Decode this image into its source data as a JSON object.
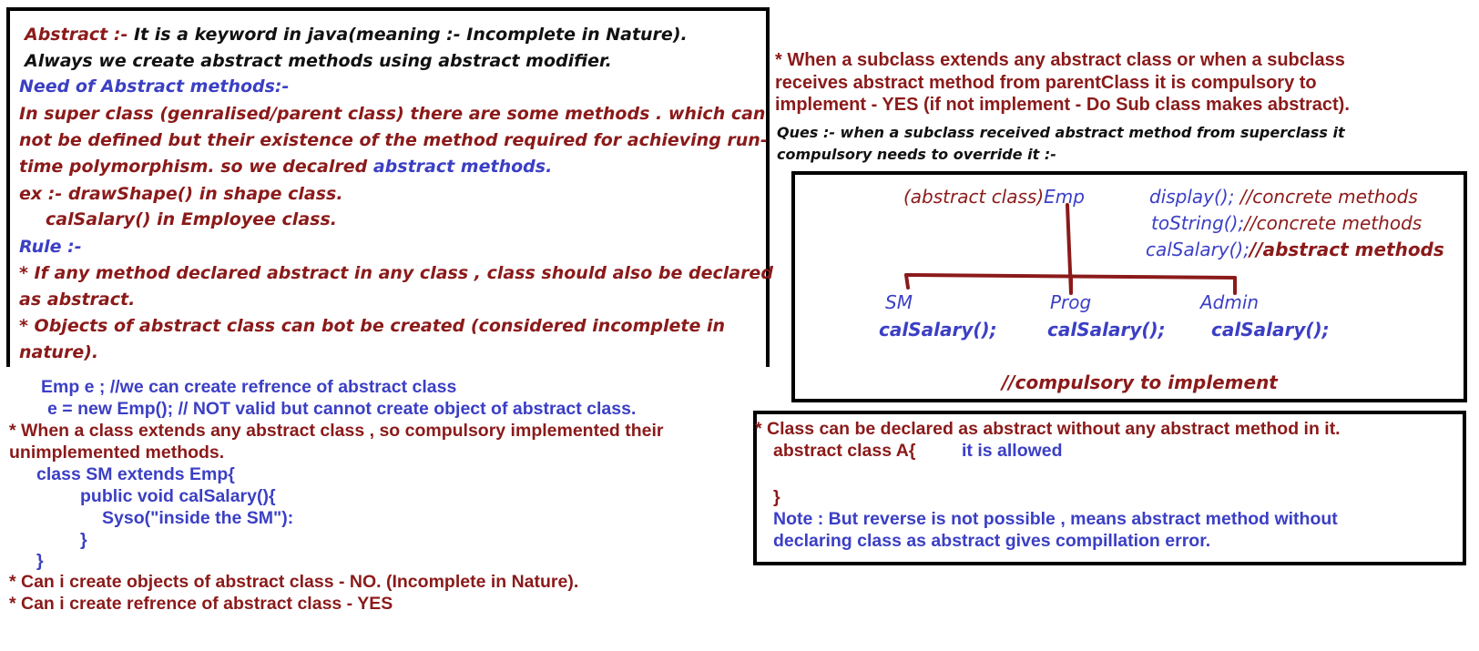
{
  "box1": {
    "line1_label": "Abstract :-",
    "line1_text": " It is a keyword in java(meaning :- Incomplete in Nature).",
    "line2": "Always we create abstract methods using abstract modifier.",
    "need_heading": "Need of Abstract methods:-",
    "need_l1": "In super class (genralised/parent class) there are some methods . which can",
    "need_l2": "not be defined but their existence of the method required for achieving run-",
    "need_l3a": "time polymorphism. so we decalred ",
    "need_l3b": "abstract methods.",
    "ex_l1": "ex :- drawShape() in shape class.",
    "ex_l2": "calSalary() in Employee class.",
    "rule_heading": "Rule :-",
    "rule1_l1": "* If any method declared abstract in any class , class should also be declared",
    "rule1_l2": "as abstract.",
    "rule2_l1": "* Objects of abstract class can bot be created (considered incomplete in",
    "rule2_l2": "nature)."
  },
  "left_bottom": {
    "l1": "Emp e ; //we can create refrence of abstract class",
    "l2": "e = new Emp(); // NOT valid but cannot create object of abstract class.",
    "l3": "* When a class extends any abstract class , so compulsory implemented their",
    "l4": "unimplemented methods.",
    "c1": "class SM extends Emp{",
    "c2": "public void calSalary(){",
    "c3": "Syso(\"inside the SM\"):",
    "c4": "}",
    "c5": "}",
    "q1": "* Can i create objects of abstract class - NO.  (Incomplete in Nature).",
    "q2": "* Can i create refrence of abstract class - YES"
  },
  "right_top": {
    "l1": "* When a subclass extends any abstract class or when  a subclass",
    "l2": "receives abstract method from parentClass it is compulsory to",
    "l3": "implement - YES (if not implement - Do Sub class makes abstract).",
    "ques_l1": "Ques :- when a subclass received abstract method from superclass it",
    "ques_l2": "compulsory needs to override it :-"
  },
  "diagram": {
    "parent_a": "(abstract class)",
    "parent_b": "Emp",
    "m1a": "display();",
    "m1b": " //concrete methods",
    "m2a": "toString();",
    "m2b": "//concrete methods",
    "m3a": "calSalary();",
    "m3b": "//abstract methods",
    "child1": "SM",
    "child2": "Prog",
    "child3": "Admin",
    "child_method": "calSalary();",
    "footer": "//compulsory to implement"
  },
  "box3": {
    "l1": "* Class can be declared as abstract without any abstract method in it.",
    "l2": "abstract class A{",
    "l2b": "it is allowed",
    "l3": "}",
    "l4": "Note : But reverse is not possible , means abstract method without",
    "l5": "declaring class as abstract gives compillation error."
  },
  "colors": {
    "maroon": "#8b1a1a",
    "blue": "#3b3fc4",
    "line": "#8b1a1a"
  }
}
